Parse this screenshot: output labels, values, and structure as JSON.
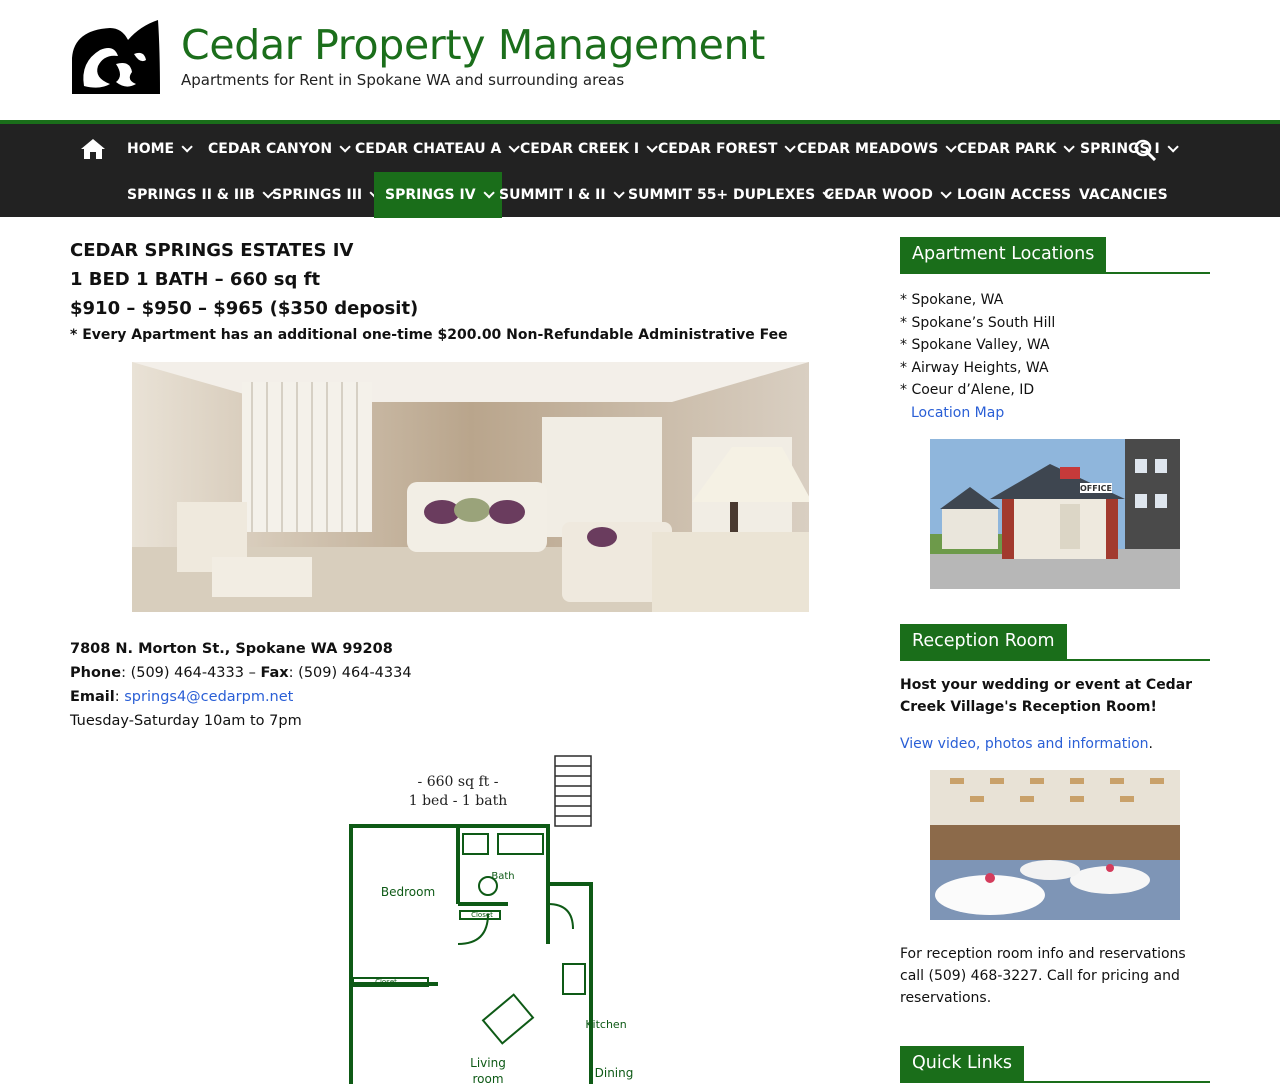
{
  "site": {
    "title": "Cedar Property Management",
    "tagline": "Apartments for Rent in Spokane WA and surrounding areas",
    "colors": {
      "brand_green": "#1a6e1a",
      "nav_bg": "#222222",
      "link_blue": "#2a5fd6"
    }
  },
  "nav": {
    "icons": {
      "home": "home-icon",
      "search": "search-icon"
    },
    "row1": [
      {
        "label": "HOME",
        "dropdown": true
      },
      {
        "label": "CEDAR CANYON",
        "dropdown": true
      },
      {
        "label": "CEDAR CHATEAU A",
        "dropdown": true
      },
      {
        "label": "CEDAR CREEK I",
        "dropdown": true
      },
      {
        "label": "CEDAR FOREST",
        "dropdown": true
      },
      {
        "label": "CEDAR MEADOWS",
        "dropdown": true
      },
      {
        "label": "CEDAR PARK",
        "dropdown": true
      },
      {
        "label": "SPRINGS I",
        "dropdown": true
      }
    ],
    "row2": [
      {
        "label": "SPRINGS II & IIB",
        "dropdown": true
      },
      {
        "label": "SPRINGS III",
        "dropdown": true
      },
      {
        "label": "SPRINGS IV",
        "dropdown": true,
        "active": true
      },
      {
        "label": "SUMMIT I & II",
        "dropdown": true
      },
      {
        "label": "SUMMIT 55+ DUPLEXES",
        "dropdown": true
      },
      {
        "label": "CEDAR WOOD",
        "dropdown": true
      },
      {
        "label": "LOGIN ACCESS",
        "dropdown": false
      },
      {
        "label": "VACANCIES",
        "dropdown": false
      }
    ]
  },
  "main": {
    "heading": "CEDAR SPRINGS ESTATES IV",
    "unit": "1 BED 1 BATH – 660 sq ft",
    "price": "$910 – $950 – $965 ($350 deposit)",
    "fee_note": "* Every Apartment has an additional one-time $200.00 Non-Refundable Administrative Fee",
    "address": "7808 N. Morton St., Spokane WA 99208",
    "phone_label": "Phone",
    "phone": "(509) 464-4333",
    "fax_label": "Fax",
    "fax": "(509) 464-4334",
    "email_label": "Email",
    "email": "springs4@cedarpm.net",
    "hours": "Tuesday-Saturday 10am to 7pm",
    "floorplan": {
      "size_text": "- 660 sq ft -",
      "bed_bath_text": "1 bed - 1 bath",
      "rooms": {
        "bedroom": "Bedroom",
        "bath": "Bath",
        "closet": "Closet",
        "kitchen": "Kitchen",
        "living_1": "Living",
        "living_2": "room",
        "dining": "Dining"
      }
    }
  },
  "sidebar": {
    "locations_title": "Apartment Locations",
    "locations": [
      "* Spokane, WA",
      "* Spokane’s South Hill",
      "* Spokane Valley, WA",
      "* Airway Heights, WA",
      "* Coeur d’Alene, ID"
    ],
    "location_map": "Location Map",
    "office_sign": "OFFICE",
    "reception_title": "Reception Room",
    "reception_bold": "Host your wedding or event at Cedar Creek Village's Reception Room!",
    "reception_link": "View video, photos and information",
    "reception_link_after": ".",
    "reception_info": "For reception room info and reservations call (509) 468-3227. Call for pricing and reservations.",
    "quick_links_title": "Quick Links"
  }
}
